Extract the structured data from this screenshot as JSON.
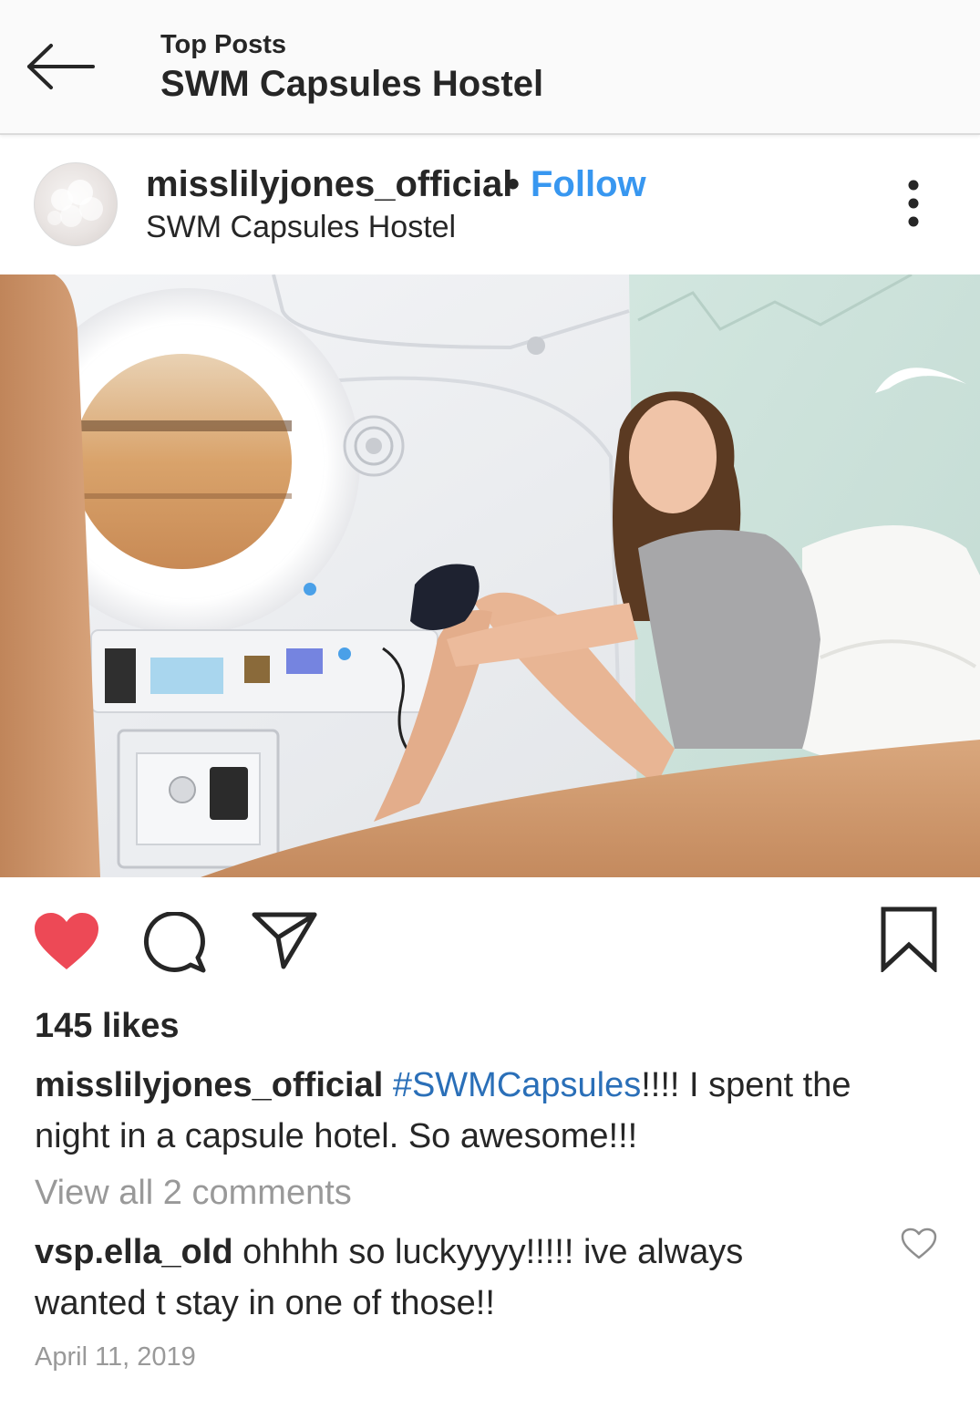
{
  "header": {
    "subtitle": "Top Posts",
    "title": "SWM Capsules Hostel"
  },
  "post": {
    "username": "misslilyjones_official",
    "separator": "•",
    "follow_label": "Follow",
    "location": "SWM Capsules Hostel",
    "likes": "145 likes",
    "liked": true,
    "caption": {
      "username": "misslilyjones_official",
      "hashtag": "#SWMCapsules",
      "text": "!!!! I spent the night in a capsule hotel. So awesome!!!"
    },
    "view_all_comments": "View all 2 comments",
    "comment": {
      "username": "vsp.ella_old",
      "text": "ohhhh so luckyyyy!!!!! ive always wanted t stay in one of those!!"
    },
    "date": "April 11, 2019"
  },
  "colors": {
    "accent": "#3897f0",
    "like_red": "#ed4956",
    "text": "#262626",
    "muted": "#999999",
    "hashtag": "#2a6fb8"
  },
  "icons": {
    "back": "arrow-left-icon",
    "more": "more-vertical-icon",
    "like": "heart-filled-icon",
    "comment": "speech-bubble-icon",
    "share": "paper-plane-icon",
    "save": "bookmark-icon",
    "comment_like": "heart-outline-icon"
  }
}
